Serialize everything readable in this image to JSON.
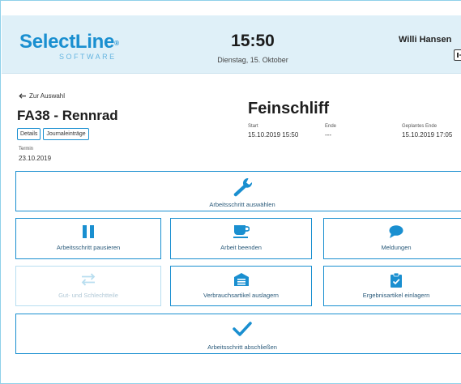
{
  "brand": {
    "name": "SelectLine",
    "sub": "SOFTWARE",
    "accent": "#1a8fd0"
  },
  "clock": {
    "time": "15:50",
    "date": "Dienstag, 15. Oktober"
  },
  "user": {
    "name": "Willi Hansen",
    "logout_icon": "logout-icon"
  },
  "order": {
    "back_label": "Zur Auswahl",
    "title": "FA38 - Rennrad",
    "tabs": [
      "Details",
      "Journaleinträge"
    ],
    "termin_label": "Termin",
    "termin_value": "23.10.2019"
  },
  "step": {
    "title": "Feinschliff",
    "start_label": "Start",
    "start_value": "15.10.2019 15:50",
    "end_label": "Ende",
    "end_value": "---",
    "planned_label": "Geplantes Ende",
    "planned_value": "15.10.2019 17:05"
  },
  "actions": {
    "select": {
      "label": "Arbeitsschritt auswählen",
      "icon": "wrench-icon"
    },
    "pause": {
      "label": "Arbeitsschritt pausieren",
      "icon": "pause-icon"
    },
    "end_work": {
      "label": "Arbeit beenden",
      "icon": "coffee-icon"
    },
    "messages": {
      "label": "Meldungen",
      "icon": "chat-icon"
    },
    "good_bad": {
      "label": "Gut- und Schlechtteile",
      "icon": "swap-icon",
      "enabled": false
    },
    "consume": {
      "label": "Verbrauchsartikel auslagern",
      "icon": "warehouse-icon"
    },
    "result": {
      "label": "Ergebnisartikel einlagern",
      "icon": "clipboard-check-icon"
    },
    "finish": {
      "label": "Arbeitsschritt abschließen",
      "icon": "checkmark-icon"
    }
  }
}
